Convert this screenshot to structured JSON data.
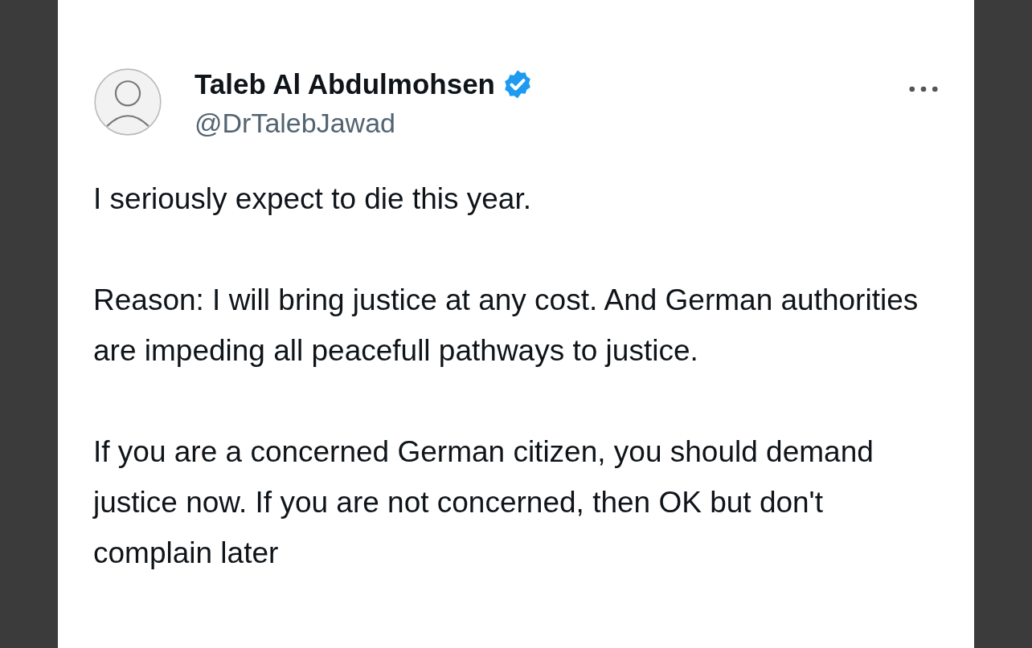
{
  "tweet": {
    "author": {
      "name": "Taleb Al Abdulmohsen",
      "handle": "@DrTalebJawad",
      "verified": true
    },
    "paragraphs": [
      "I seriously expect to die this year.",
      "Reason: I will bring justice at any cost. And German authorities are impeding all peacefull pathways to justice.",
      "If you are a concerned German citizen, you should demand justice now. If you are not concerned, then OK but don't complain later"
    ]
  }
}
